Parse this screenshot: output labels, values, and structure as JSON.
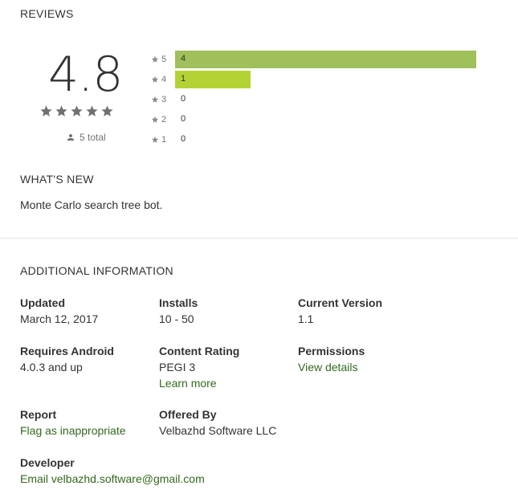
{
  "reviews": {
    "title": "REVIEWS",
    "score": "4.8",
    "total": "5 total",
    "histogram": [
      {
        "label": "5",
        "count": "4",
        "fraction": 1.0,
        "color": "#9fc05a"
      },
      {
        "label": "4",
        "count": "1",
        "fraction": 0.25,
        "color": "#b3d334"
      },
      {
        "label": "3",
        "count": "0",
        "fraction": 0,
        "color": "#ffd54f"
      },
      {
        "label": "2",
        "count": "0",
        "fraction": 0,
        "color": "#ffb74d"
      },
      {
        "label": "1",
        "count": "0",
        "fraction": 0,
        "color": "#ff8a65"
      }
    ]
  },
  "whats_new": {
    "title": "WHAT'S NEW",
    "text": "Monte Carlo search tree bot."
  },
  "additional": {
    "title": "ADDITIONAL INFORMATION",
    "updated": {
      "title": "Updated",
      "value": "March 12, 2017"
    },
    "installs": {
      "title": "Installs",
      "value": "10 - 50"
    },
    "current_version": {
      "title": "Current Version",
      "value": "1.1"
    },
    "requires_android": {
      "title": "Requires Android",
      "value": "4.0.3 and up"
    },
    "content_rating": {
      "title": "Content Rating",
      "value": "PEGI 3",
      "link": "Learn more"
    },
    "permissions": {
      "title": "Permissions",
      "link": "View details"
    },
    "report": {
      "title": "Report",
      "link": "Flag as inappropriate"
    },
    "offered_by": {
      "title": "Offered By",
      "value": "Velbazhd Software LLC"
    },
    "developer": {
      "title": "Developer",
      "link": "Email velbazhd.software@gmail.com"
    }
  },
  "colors": {
    "link": "#33691e",
    "star": "#707070"
  }
}
